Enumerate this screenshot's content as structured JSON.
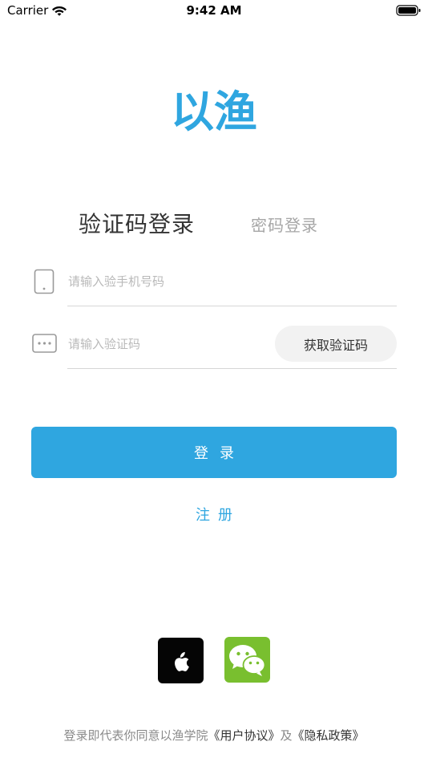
{
  "status_bar": {
    "carrier": "Carrier",
    "time": "9:42 AM"
  },
  "logo": {
    "text": "以渔",
    "color": "#2fa6e0"
  },
  "tabs": {
    "sms_login": "验证码登录",
    "password_login": "密码登录",
    "active": "sms_login"
  },
  "form": {
    "phone": {
      "placeholder": "请输入验手机号码",
      "value": "",
      "icon": "phone-icon"
    },
    "code": {
      "placeholder": "请输入验证码",
      "value": "",
      "icon": "dots-icon"
    },
    "get_code_label": "获取验证码"
  },
  "login_button_label": "登录",
  "register_label": "注册",
  "social": {
    "apple": "apple-icon",
    "wechat": "wechat-icon"
  },
  "agreement": {
    "prefix": "登录即代表你同意以渔学院",
    "user_agreement": "《用户协议》",
    "joiner": "及",
    "privacy_policy": "《隐私政策》"
  },
  "colors": {
    "accent": "#2fa6e0",
    "wechat": "#79bf2f",
    "apple": "#050505"
  }
}
